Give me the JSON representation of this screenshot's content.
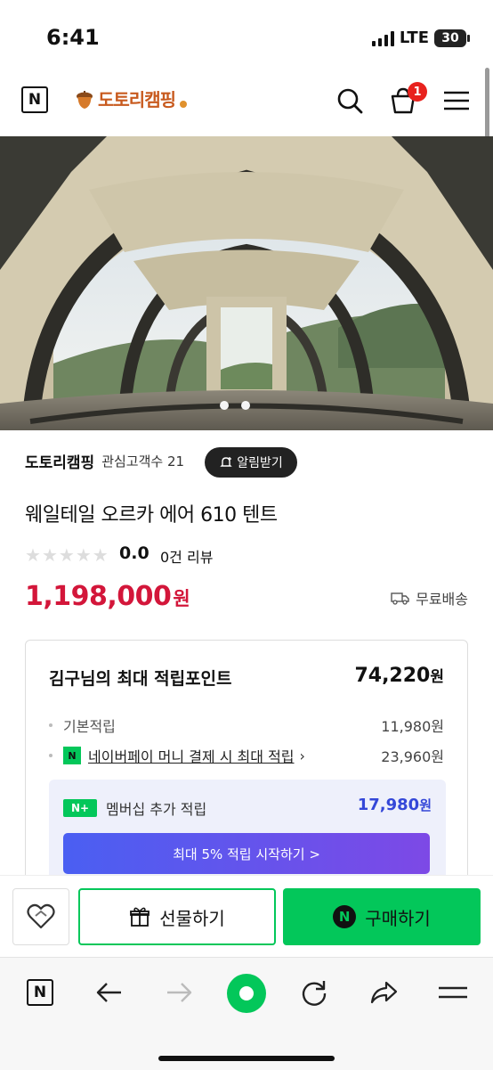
{
  "status_bar": {
    "time": "6:41",
    "network": "LTE",
    "battery": "30"
  },
  "header": {
    "naver_logo": "N",
    "store_logo_text": "도토리캠핑",
    "cart_count": "1",
    "icons": [
      "search-icon",
      "cart-icon",
      "menu-icon"
    ]
  },
  "hero": {
    "slides_visible": 2,
    "active_slide": 1
  },
  "store": {
    "name": "도토리캠핑",
    "fans": "관심고객수 21",
    "notify_label": "알림받기"
  },
  "product": {
    "title": "웨일테일 오르카 에어 610 텐트",
    "rating": "0.0",
    "rating_stars": 0,
    "reviews": "0건 리뷰",
    "price": "1,198,000",
    "currency": "원",
    "shipping": "무료배송"
  },
  "points": {
    "headline": "김구님의 최대 적립포인트",
    "total": "74,220",
    "total_unit": "원",
    "basic_label": "기본적립",
    "basic_value": "11,980원",
    "npay_badge": "N",
    "npay_label": "네이버페이 머니 결제 시 최대 적립",
    "npay_value": "23,960원",
    "membership_badge": "N+",
    "membership_label": "멤버십 추가 적립",
    "membership_value": "17,980",
    "membership_unit": "원",
    "cta": "최대 5% 적립 시작하기 >"
  },
  "actions": {
    "gift_label": "선물하기",
    "buy_label": "구매하기",
    "buy_badge": "N"
  },
  "colors": {
    "naver_green": "#03c75a",
    "price_red": "#d3163a",
    "point_blue": "#3447d8",
    "brand_orange": "#c85a1e"
  }
}
